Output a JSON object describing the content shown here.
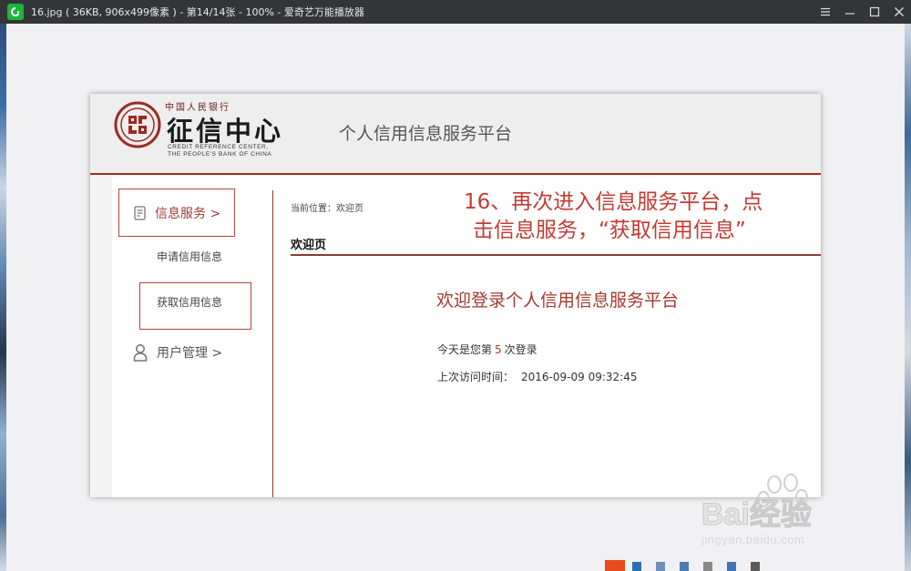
{
  "window": {
    "title": "16.jpg ( 36KB, 906x499像素 ) - 第14/14张 - 100% - 爱奇艺万能播放器",
    "app_icon": "iqiyi-player-icon",
    "controls": [
      "menu-icon",
      "minimize-icon",
      "maximize-icon",
      "close-icon"
    ]
  },
  "page": {
    "logo": {
      "top_text": "中国人民银行",
      "main_text": "征信中心",
      "en_line1": "CREDIT REFERENCE CENTER,",
      "en_line2": "THE PEOPLE'S BANK OF CHINA"
    },
    "platform_title": "个人信用信息服务平台",
    "sidebar": {
      "info_service": "信息服务 >",
      "apply_credit": "申请信用信息",
      "get_credit": "获取信用信息",
      "user_manage": "用户管理 >"
    },
    "breadcrumb": "当前位置：欢迎页",
    "annotation": {
      "line1": "16、再次进入信息服务平台，点",
      "line2": "击信息服务，“获取信用信息”"
    },
    "section_title": "欢迎页",
    "welcome": "欢迎登录个人信用信息服务平台",
    "login": {
      "prefix": "今天是您第",
      "count": "5",
      "suffix": "次登录"
    },
    "last_visit": {
      "label": "上次访问时间：",
      "value": "2016-09-09 09:32:45"
    }
  },
  "watermark": {
    "brand": "Bai经验",
    "url": "jingyan.baidu.com"
  },
  "colors": {
    "titlebar": "#333638",
    "accent_red": "#a82a20",
    "viewer_bg": "#f1f1f3"
  }
}
